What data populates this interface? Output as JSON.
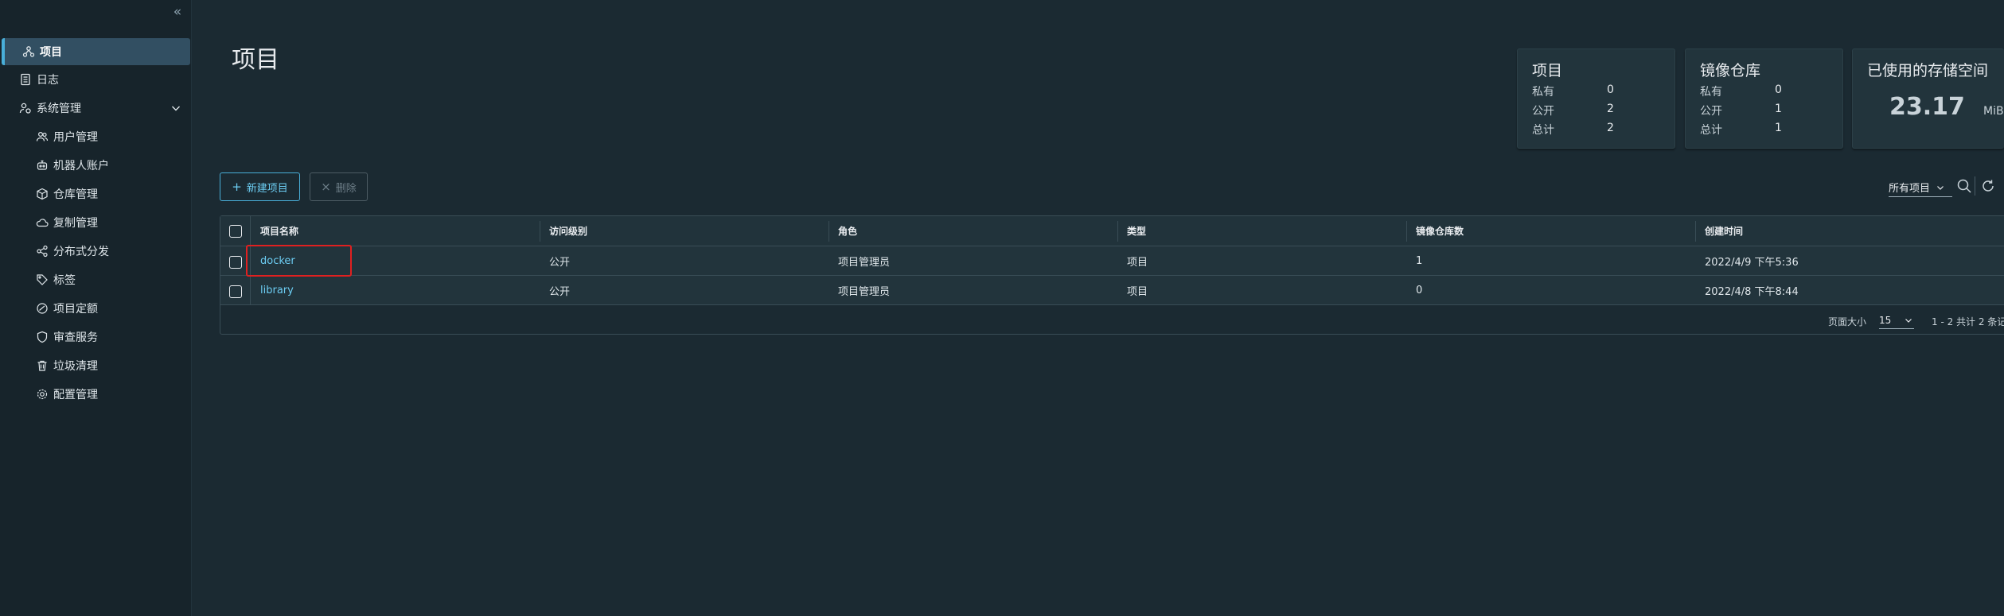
{
  "sidebar": {
    "items": [
      {
        "label": "项目",
        "icon": "projects-icon"
      },
      {
        "label": "日志",
        "icon": "logs-icon"
      },
      {
        "label": "系统管理",
        "icon": "system-admin-icon"
      },
      {
        "label": "用户管理",
        "icon": "users-icon"
      },
      {
        "label": "机器人账户",
        "icon": "robot-icon"
      },
      {
        "label": "仓库管理",
        "icon": "registry-icon"
      },
      {
        "label": "复制管理",
        "icon": "replication-icon"
      },
      {
        "label": "分布式分发",
        "icon": "distribution-icon"
      },
      {
        "label": "标签",
        "icon": "tag-icon"
      },
      {
        "label": "项目定额",
        "icon": "quota-icon"
      },
      {
        "label": "审查服务",
        "icon": "shield-icon"
      },
      {
        "label": "垃圾清理",
        "icon": "trash-icon"
      },
      {
        "label": "配置管理",
        "icon": "gear-icon"
      }
    ]
  },
  "main": {
    "title": "项目",
    "cards": {
      "projects": {
        "title": "项目",
        "rows": [
          {
            "label": "私有",
            "value": "0"
          },
          {
            "label": "公开",
            "value": "2"
          },
          {
            "label": "总计",
            "value": "2"
          }
        ]
      },
      "repos": {
        "title": "镜像仓库",
        "rows": [
          {
            "label": "私有",
            "value": "0"
          },
          {
            "label": "公开",
            "value": "1"
          },
          {
            "label": "总计",
            "value": "1"
          }
        ]
      },
      "storage": {
        "title": "已使用的存储空间",
        "value": "23.17",
        "unit": "MiB"
      }
    },
    "toolbar": {
      "new_label": "新建项目",
      "delete_label": "删除",
      "filter_value": "所有项目"
    },
    "table": {
      "columns": [
        "项目名称",
        "访问级别",
        "角色",
        "类型",
        "镜像仓库数",
        "创建时间"
      ],
      "rows": [
        {
          "name": "docker",
          "access": "公开",
          "role": "项目管理员",
          "type": "项目",
          "repo_count": "1",
          "created": "2022/4/9 下午5:36"
        },
        {
          "name": "library",
          "access": "公开",
          "role": "项目管理员",
          "type": "项目",
          "repo_count": "0",
          "created": "2022/4/8 下午8:44"
        }
      ],
      "footer": {
        "page_size_label": "页面大小",
        "page_size": "15",
        "range": "1 - 2 共计 2 条记"
      }
    }
  },
  "colors": {
    "accent": "#49afd9",
    "link": "#6ccdf3",
    "highlight_box": "#e02020",
    "background": "#1b2a32",
    "sidebar": "#17242b"
  }
}
